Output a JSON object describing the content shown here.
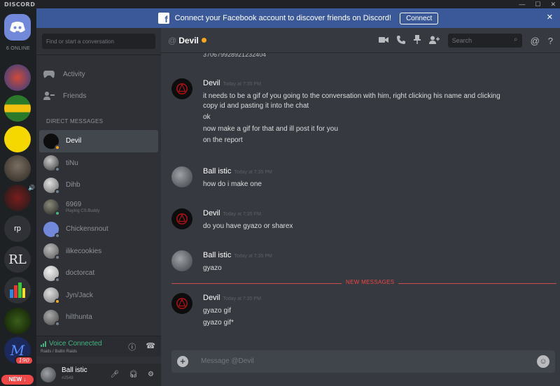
{
  "window": {
    "logo": "DISCORD",
    "minimize": "—",
    "maximize": "☐",
    "close": "✕"
  },
  "guilds": {
    "online_count": "6 ONLINE",
    "rp_label": "rp",
    "badge_count": "190",
    "new_label": "NEW ↓"
  },
  "banner": {
    "text": "Connect your Facebook account to discover friends on Discord!",
    "button": "Connect",
    "close": "✕"
  },
  "sidebar": {
    "search_placeholder": "Find or start a conversation",
    "activity_label": "Activity",
    "friends_label": "Friends",
    "dm_header": "DIRECT MESSAGES",
    "dms": [
      {
        "name": "Devil",
        "sub": "",
        "status": "#faa61a"
      },
      {
        "name": "tiNu",
        "sub": "",
        "status": "#747f8d"
      },
      {
        "name": "Dihb",
        "sub": "",
        "status": "#747f8d"
      },
      {
        "name": "6969",
        "sub": "Playing CS:Buddy",
        "status": "#43b581"
      },
      {
        "name": "Chickensnout",
        "sub": "",
        "status": "#747f8d"
      },
      {
        "name": "ilikecookies",
        "sub": "",
        "status": "#747f8d"
      },
      {
        "name": "doctorcat",
        "sub": "",
        "status": "#747f8d"
      },
      {
        "name": "Jyn/Jack",
        "sub": "",
        "status": "#faa61a"
      },
      {
        "name": "hilthunta",
        "sub": "",
        "status": "#747f8d"
      }
    ]
  },
  "voice": {
    "status": "Voice Connected",
    "channel": "Raids / Ballin Raids"
  },
  "user": {
    "name": "Ball istic",
    "tag": "#2548"
  },
  "chat": {
    "at": "@",
    "channel_name": "Devil",
    "search_placeholder": "Search",
    "cut_line": "370679928921232404",
    "new_messages_label": "NEW MESSAGES",
    "input_placeholder": "Message @Devil",
    "groups": [
      {
        "author": "Devil",
        "time": "Today at 7:35 PM",
        "lines": [
          "it needs to be a gif of you going to the conversation with him, right clicking his name and clicking",
          "copy id and pasting it into the chat",
          "ok",
          "now make a gif for that and ill post it for you",
          "on the report"
        ]
      },
      {
        "author": "Ball istic",
        "time": "Today at 7:35 PM",
        "lines": [
          "how do i make one"
        ]
      },
      {
        "author": "Devil",
        "time": "Today at 7:35 PM",
        "lines": [
          "do you have gyazo or sharex"
        ]
      },
      {
        "author": "Ball istic",
        "time": "Today at 7:35 PM",
        "lines": [
          "gyazo"
        ]
      },
      {
        "author": "Devil",
        "time": "Today at 7:35 PM",
        "lines": [
          "gyazo gif",
          "gyazo gif*"
        ]
      }
    ]
  },
  "colors": {
    "blurple": "#7289da",
    "facebook": "#3b5998",
    "online": "#43b581",
    "idle": "#faa61a",
    "offline": "#747f8d",
    "danger": "#f04747"
  }
}
